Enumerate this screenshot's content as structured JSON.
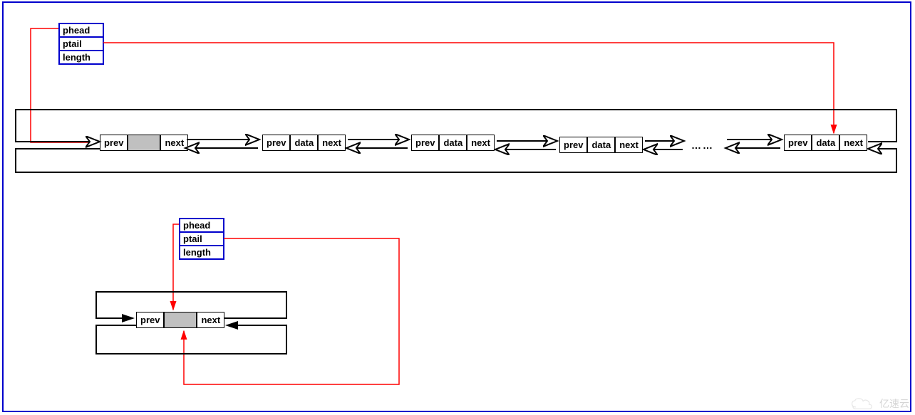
{
  "diagram": {
    "header1": {
      "phead": "phead",
      "ptail": "ptail",
      "length": "length"
    },
    "header2": {
      "phead": "phead",
      "ptail": "ptail",
      "length": "length"
    },
    "nodes": {
      "sentinel": {
        "prev": "prev",
        "next": "next"
      },
      "n1": {
        "prev": "prev",
        "data": "data",
        "next": "next"
      },
      "n2": {
        "prev": "prev",
        "data": "data",
        "next": "next"
      },
      "n3": {
        "prev": "prev",
        "data": "data",
        "next": "next"
      },
      "nlast": {
        "prev": "prev",
        "data": "data",
        "next": "next"
      }
    },
    "ellipsis": "……",
    "singleNode": {
      "prev": "prev",
      "next": "next"
    },
    "watermark": "亿速云"
  }
}
